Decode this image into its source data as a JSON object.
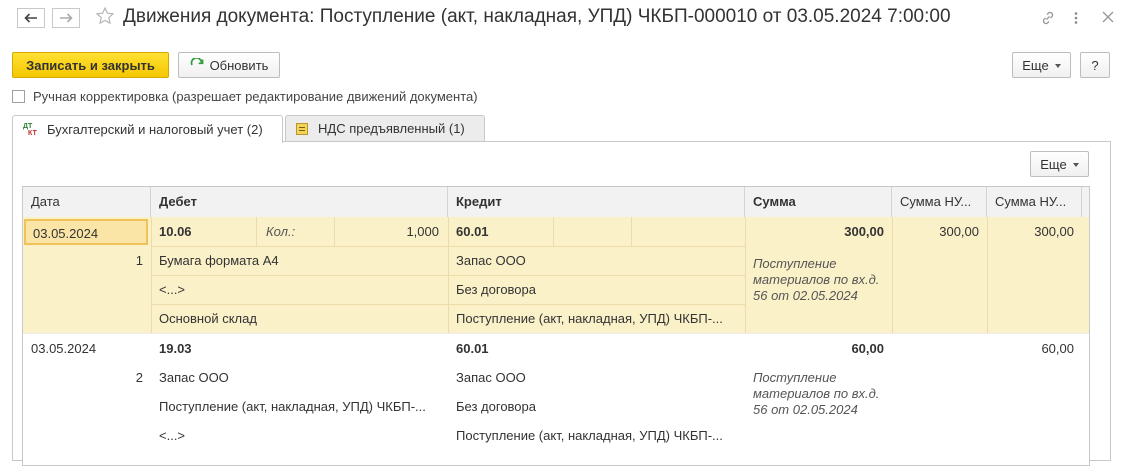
{
  "window": {
    "title": "Движения документа: Поступление (акт, накладная, УПД) ЧКБП-000010 от 03.05.2024 7:00:00"
  },
  "toolbar": {
    "save_close": "Записать и закрыть",
    "refresh": "Обновить",
    "more": "Еще",
    "help": "?"
  },
  "manual_correction": {
    "label": "Ручная корректировка (разрешает редактирование движений документа)",
    "checked": false
  },
  "tabs": [
    {
      "label": "Бухгалтерский и налоговый учет (2)",
      "icon": "dt-kt-icon",
      "active": true
    },
    {
      "label": "НДС предъявленный (1)",
      "icon": "register-icon",
      "active": false
    }
  ],
  "table_toolbar": {
    "more": "Еще"
  },
  "table": {
    "headers": [
      "Дата",
      "Дебет",
      "Кредит",
      "Сумма",
      "Сумма НУ...",
      "Сумма НУ..."
    ],
    "rows": [
      {
        "date": "03.05.2024",
        "num": "1",
        "debit_account": "10.06",
        "qty_label": "Кол.:",
        "qty": "1,000",
        "debit_sub1": "Бумага формата А4",
        "debit_sub2": "<...>",
        "debit_sub3": "Основной склад",
        "credit_account": "60.01",
        "credit_sub1": "Запас ООО",
        "credit_sub2": "Без договора",
        "credit_sub3": "Поступление (акт, накладная, УПД) ЧКБП-...",
        "sum": "300,00",
        "content_1": "Поступление",
        "content_2": "материалов по вх.д.",
        "content_3": "56 от 02.05.2024",
        "sum_nu_dt": "300,00",
        "sum_nu_kt": "300,00"
      },
      {
        "date": "03.05.2024",
        "num": "2",
        "debit_account": "19.03",
        "debit_sub1": "Запас ООО",
        "debit_sub2": "Поступление (акт, накладная, УПД) ЧКБП-...",
        "debit_sub3": "<...>",
        "credit_account": "60.01",
        "credit_sub1": "Запас ООО",
        "credit_sub2": "Без договора",
        "credit_sub3": "Поступление (акт, накладная, УПД) ЧКБП-...",
        "sum": "60,00",
        "content_1": "Поступление",
        "content_2": "материалов по вх.д.",
        "content_3": "56 от 02.05.2024",
        "sum_nu_dt": "",
        "sum_nu_kt": "60,00"
      }
    ]
  }
}
